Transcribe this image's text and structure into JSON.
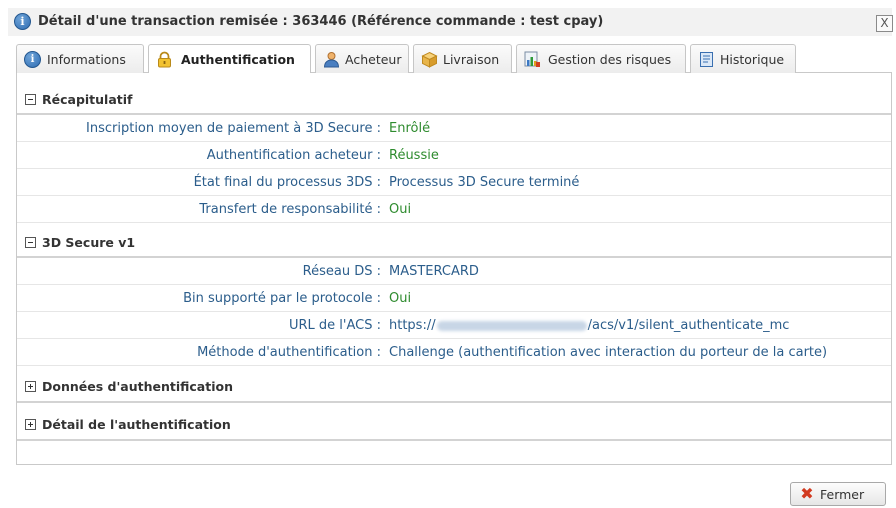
{
  "dialog": {
    "title": "Détail d'une transaction remisée : 363446 (Référence commande : test cpay)",
    "close_glyph": "X"
  },
  "tabs": [
    {
      "label": "Informations",
      "icon": "info-icon",
      "active": false
    },
    {
      "label": "Authentification",
      "icon": "lock-icon",
      "active": true
    },
    {
      "label": "Acheteur",
      "icon": "user-icon",
      "active": false
    },
    {
      "label": "Livraison",
      "icon": "package-icon",
      "active": false
    },
    {
      "label": "Gestion des risques",
      "icon": "chart-icon",
      "active": false
    },
    {
      "label": "Historique",
      "icon": "document-icon",
      "active": false
    }
  ],
  "sections": {
    "recap": {
      "title": "Récapitulatif",
      "expanded": true,
      "rows": [
        {
          "label": "Inscription moyen de paiement à 3D Secure :",
          "value": "Enrôlé"
        },
        {
          "label": "Authentification acheteur :",
          "value": "Réussie"
        },
        {
          "label": "État final du processus 3DS :",
          "value": "Processus 3D Secure terminé"
        },
        {
          "label": "Transfert de responsabilité :",
          "value": "Oui"
        }
      ]
    },
    "v1": {
      "title": "3D Secure v1",
      "expanded": true,
      "rows": [
        {
          "label": "Réseau DS :",
          "value": "MASTERCARD"
        },
        {
          "label": "Bin supporté par le protocole :",
          "value": "Oui"
        },
        {
          "label": "URL de l'ACS :",
          "value_prefix": "https://",
          "value_suffix": "/acs/v1/silent_authenticate_mc"
        },
        {
          "label": "Méthode d'authentification :",
          "value": "Challenge (authentification avec interaction du porteur de la carte)"
        }
      ]
    },
    "auth_data": {
      "title": "Données d'authentification",
      "expanded": false
    },
    "auth_detail": {
      "title": "Détail de l'authentification",
      "expanded": false
    }
  },
  "footer": {
    "close_label": "Fermer"
  },
  "colors": {
    "label_blue": "#2b5d8b",
    "value_green": "#2e8b2e",
    "close_red": "#d23a1f"
  }
}
